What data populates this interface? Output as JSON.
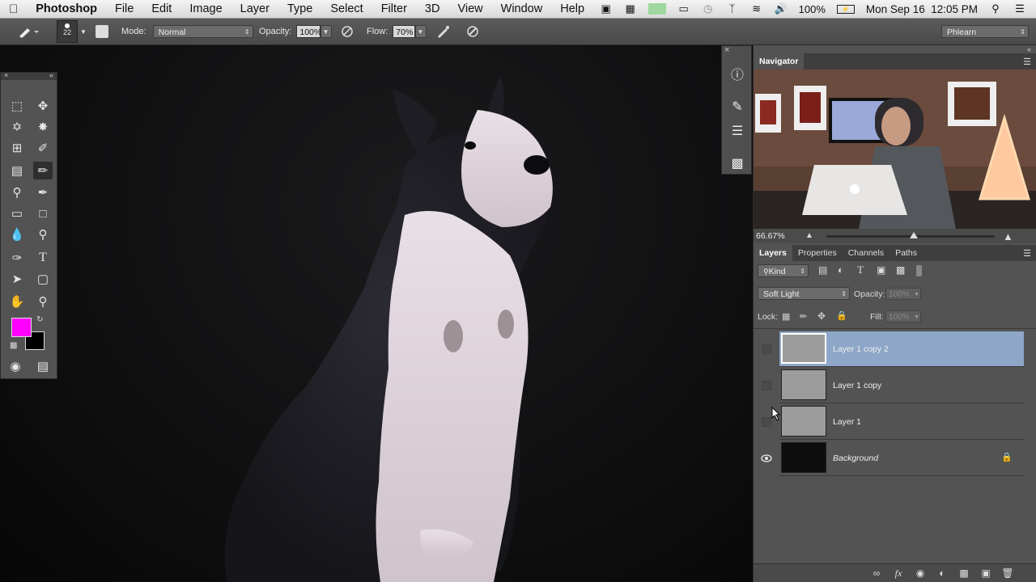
{
  "menubar": {
    "apple_icon": "apple-icon",
    "items": [
      "Photoshop",
      "File",
      "Edit",
      "Image",
      "Layer",
      "Type",
      "Select",
      "Filter",
      "3D",
      "View",
      "Window",
      "Help"
    ],
    "battery": "100%",
    "datetime": "Mon Sep 16  12:05 PM"
  },
  "options": {
    "brush_size": "22",
    "mode_label": "Mode:",
    "mode_value": "Normal",
    "opacity_label": "Opacity:",
    "opacity_value": "100%",
    "flow_label": "Flow:",
    "flow_value": "70%",
    "workspace": "Phlearn"
  },
  "navigator": {
    "tab": "Navigator",
    "zoom": "66.67%",
    "zoom_slider_fraction": 0.52
  },
  "layers_panel": {
    "tabs": [
      "Layers",
      "Properties",
      "Channels",
      "Paths"
    ],
    "active_tab": "Layers",
    "kind_filter": "Kind",
    "blend_mode": "Soft Light",
    "opacity_label": "Opacity:",
    "opacity_value": "100%",
    "lock_label": "Lock:",
    "fill_label": "Fill:",
    "fill_value": "100%",
    "layers": [
      {
        "name": "Layer 1 copy 2",
        "visible": false,
        "selected": true
      },
      {
        "name": "Layer 1 copy",
        "visible": false,
        "selected": false
      },
      {
        "name": "Layer 1",
        "visible": false,
        "selected": false
      },
      {
        "name": "Background",
        "visible": true,
        "selected": false,
        "locked": true
      }
    ]
  },
  "colors": {
    "foreground": "#ff00ff",
    "background": "#000000",
    "selection": "#8ea6c7"
  }
}
